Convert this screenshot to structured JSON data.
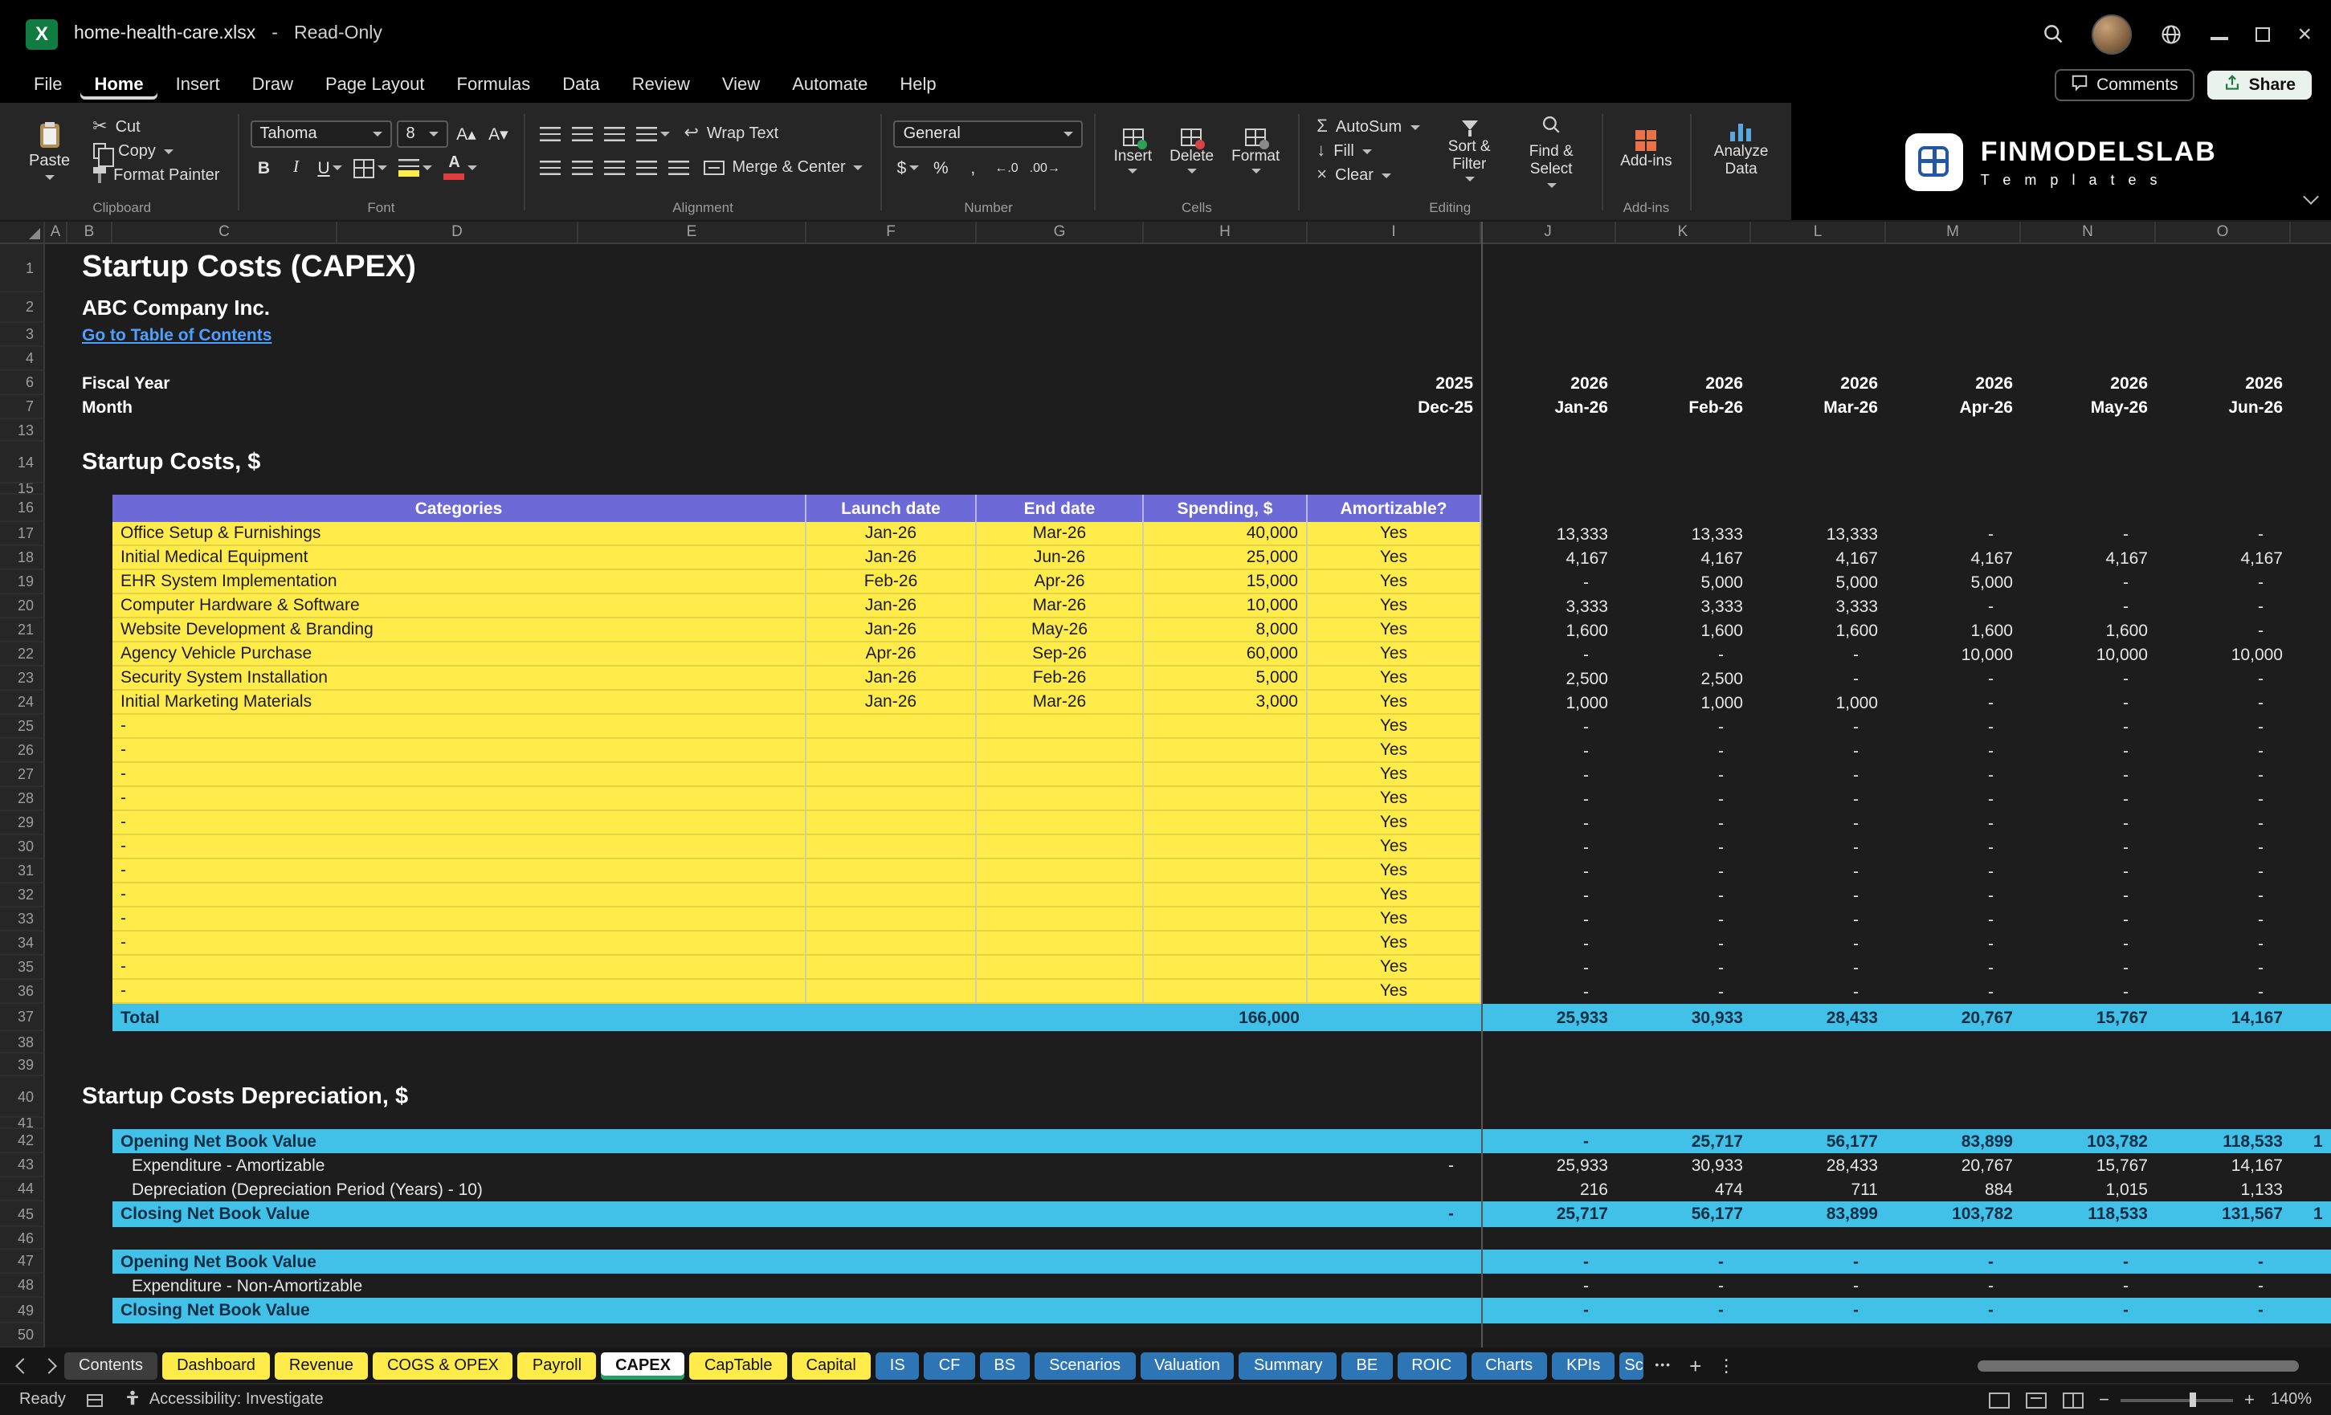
{
  "window": {
    "file_name": "home-health-care.xlsx",
    "separator": "-",
    "mode": "Read-Only"
  },
  "menu": {
    "items": [
      "File",
      "Home",
      "Insert",
      "Draw",
      "Page Layout",
      "Formulas",
      "Data",
      "Review",
      "View",
      "Automate",
      "Help"
    ],
    "active_item": "Home",
    "comments_label": "Comments",
    "share_label": "Share"
  },
  "ribbon": {
    "groups": [
      "Clipboard",
      "Font",
      "Alignment",
      "Number",
      "Cells",
      "Editing",
      "Add-ins"
    ],
    "paste": "Paste",
    "cut": "Cut",
    "copy": "Copy",
    "format_painter": "Format Painter",
    "font_name": "Tahoma",
    "font_size": "8",
    "wrap_text": "Wrap Text",
    "merge_center": "Merge & Center",
    "number_format": "General",
    "insert": "Insert",
    "delete": "Delete",
    "format": "Format",
    "autosum": "AutoSum",
    "fill": "Fill",
    "clear": "Clear",
    "sort_filter": "Sort & Filter",
    "find_select": "Find & Select",
    "addins": "Add-ins",
    "analyze_data": "Analyze Data"
  },
  "logo": {
    "title": "FINMODELSLAB",
    "subtitle": "T e m p l a t e s"
  },
  "grid": {
    "columns": [
      "A",
      "B",
      "C",
      "D",
      "E",
      "F",
      "G",
      "H",
      "I",
      "J",
      "K",
      "L",
      "M",
      "N",
      "O"
    ],
    "rows": [
      {
        "n": "1",
        "h": 30,
        "kind": "title",
        "text": "Startup Costs (CAPEX)"
      },
      {
        "n": "2",
        "h": 19,
        "kind": "subtitle",
        "text": "ABC Company Inc."
      },
      {
        "n": "3",
        "h": 15,
        "kind": "link",
        "text": "Go to Table of Contents"
      },
      {
        "n": "4",
        "h": 15,
        "kind": "blank"
      },
      {
        "n": "6",
        "h": 15,
        "kind": "dates",
        "label": "Fiscal Year",
        "dec": "2025",
        "m": [
          "2026",
          "2026",
          "2026",
          "2026",
          "2026",
          "2026"
        ]
      },
      {
        "n": "7",
        "h": 15,
        "kind": "dates",
        "label": "Month",
        "dec": "Dec-25",
        "m": [
          "Jan-26",
          "Feb-26",
          "Mar-26",
          "Apr-26",
          "May-26",
          "Jun-26"
        ]
      },
      {
        "n": "13",
        "h": 14,
        "kind": "blank"
      },
      {
        "n": "14",
        "h": 26,
        "kind": "section",
        "text": "Startup Costs, $"
      },
      {
        "n": "15",
        "h": 7,
        "kind": "blank"
      },
      {
        "n": "16",
        "h": 17,
        "kind": "thead",
        "c1": "Categories",
        "c2": "Launch date",
        "c3": "End date",
        "c4": "Spending, $",
        "c5": "Amortizable?"
      },
      {
        "n": "17",
        "h": 15,
        "kind": "item",
        "cat": "Office Setup & Furnishings",
        "launch": "Jan-26",
        "end": "Mar-26",
        "spend": "40,000",
        "amort": "Yes",
        "m": [
          "13,333",
          "13,333",
          "13,333",
          "-",
          "-",
          "-"
        ]
      },
      {
        "n": "18",
        "h": 15,
        "kind": "item",
        "cat": "Initial Medical Equipment",
        "launch": "Jan-26",
        "end": "Jun-26",
        "spend": "25,000",
        "amort": "Yes",
        "m": [
          "4,167",
          "4,167",
          "4,167",
          "4,167",
          "4,167",
          "4,167"
        ]
      },
      {
        "n": "19",
        "h": 15,
        "kind": "item",
        "cat": "EHR System Implementation",
        "launch": "Feb-26",
        "end": "Apr-26",
        "spend": "15,000",
        "amort": "Yes",
        "m": [
          "-",
          "5,000",
          "5,000",
          "5,000",
          "-",
          "-"
        ]
      },
      {
        "n": "20",
        "h": 15,
        "kind": "item",
        "cat": "Computer Hardware & Software",
        "launch": "Jan-26",
        "end": "Mar-26",
        "spend": "10,000",
        "amort": "Yes",
        "m": [
          "3,333",
          "3,333",
          "3,333",
          "-",
          "-",
          "-"
        ]
      },
      {
        "n": "21",
        "h": 15,
        "kind": "item",
        "cat": "Website Development & Branding",
        "launch": "Jan-26",
        "end": "May-26",
        "spend": "8,000",
        "amort": "Yes",
        "m": [
          "1,600",
          "1,600",
          "1,600",
          "1,600",
          "1,600",
          "-"
        ]
      },
      {
        "n": "22",
        "h": 15,
        "kind": "item",
        "cat": "Agency Vehicle Purchase",
        "launch": "Apr-26",
        "end": "Sep-26",
        "spend": "60,000",
        "amort": "Yes",
        "m": [
          "-",
          "-",
          "-",
          "10,000",
          "10,000",
          "10,000"
        ]
      },
      {
        "n": "23",
        "h": 15,
        "kind": "item",
        "cat": "Security System Installation",
        "launch": "Jan-26",
        "end": "Feb-26",
        "spend": "5,000",
        "amort": "Yes",
        "m": [
          "2,500",
          "2,500",
          "-",
          "-",
          "-",
          "-"
        ]
      },
      {
        "n": "24",
        "h": 15,
        "kind": "item",
        "cat": "Initial Marketing Materials",
        "launch": "Jan-26",
        "end": "Mar-26",
        "spend": "3,000",
        "amort": "Yes",
        "m": [
          "1,000",
          "1,000",
          "1,000",
          "-",
          "-",
          "-"
        ]
      },
      {
        "n": "25",
        "h": 15,
        "kind": "item",
        "cat": "-",
        "launch": "",
        "end": "",
        "spend": "",
        "amort": "Yes",
        "m": [
          "-",
          "-",
          "-",
          "-",
          "-",
          "-"
        ]
      },
      {
        "n": "26",
        "h": 15,
        "kind": "item",
        "cat": "-",
        "launch": "",
        "end": "",
        "spend": "",
        "amort": "Yes",
        "m": [
          "-",
          "-",
          "-",
          "-",
          "-",
          "-"
        ]
      },
      {
        "n": "27",
        "h": 15,
        "kind": "item",
        "cat": "-",
        "launch": "",
        "end": "",
        "spend": "",
        "amort": "Yes",
        "m": [
          "-",
          "-",
          "-",
          "-",
          "-",
          "-"
        ]
      },
      {
        "n": "28",
        "h": 15,
        "kind": "item",
        "cat": "-",
        "launch": "",
        "end": "",
        "spend": "",
        "amort": "Yes",
        "m": [
          "-",
          "-",
          "-",
          "-",
          "-",
          "-"
        ]
      },
      {
        "n": "29",
        "h": 15,
        "kind": "item",
        "cat": "-",
        "launch": "",
        "end": "",
        "spend": "",
        "amort": "Yes",
        "m": [
          "-",
          "-",
          "-",
          "-",
          "-",
          "-"
        ]
      },
      {
        "n": "30",
        "h": 15,
        "kind": "item",
        "cat": "-",
        "launch": "",
        "end": "",
        "spend": "",
        "amort": "Yes",
        "m": [
          "-",
          "-",
          "-",
          "-",
          "-",
          "-"
        ]
      },
      {
        "n": "31",
        "h": 15,
        "kind": "item",
        "cat": "-",
        "launch": "",
        "end": "",
        "spend": "",
        "amort": "Yes",
        "m": [
          "-",
          "-",
          "-",
          "-",
          "-",
          "-"
        ]
      },
      {
        "n": "32",
        "h": 15,
        "kind": "item",
        "cat": "-",
        "launch": "",
        "end": "",
        "spend": "",
        "amort": "Yes",
        "m": [
          "-",
          "-",
          "-",
          "-",
          "-",
          "-"
        ]
      },
      {
        "n": "33",
        "h": 15,
        "kind": "item",
        "cat": "-",
        "launch": "",
        "end": "",
        "spend": "",
        "amort": "Yes",
        "m": [
          "-",
          "-",
          "-",
          "-",
          "-",
          "-"
        ]
      },
      {
        "n": "34",
        "h": 15,
        "kind": "item",
        "cat": "-",
        "launch": "",
        "end": "",
        "spend": "",
        "amort": "Yes",
        "m": [
          "-",
          "-",
          "-",
          "-",
          "-",
          "-"
        ]
      },
      {
        "n": "35",
        "h": 15,
        "kind": "item",
        "cat": "-",
        "launch": "",
        "end": "",
        "spend": "",
        "amort": "Yes",
        "m": [
          "-",
          "-",
          "-",
          "-",
          "-",
          "-"
        ]
      },
      {
        "n": "36",
        "h": 15,
        "kind": "item",
        "cat": "-",
        "launch": "",
        "end": "",
        "spend": "",
        "amort": "Yes",
        "m": [
          "-",
          "-",
          "-",
          "-",
          "-",
          "-"
        ]
      },
      {
        "n": "37",
        "h": 17,
        "kind": "total",
        "label": "Total",
        "spend": "166,000",
        "m": [
          "25,933",
          "30,933",
          "28,433",
          "20,767",
          "15,767",
          "14,167"
        ]
      },
      {
        "n": "38",
        "h": 14,
        "kind": "blank"
      },
      {
        "n": "39",
        "h": 14,
        "kind": "blank"
      },
      {
        "n": "40",
        "h": 26,
        "kind": "section",
        "text": "Startup Costs Depreciation, $"
      },
      {
        "n": "41",
        "h": 7,
        "kind": "blank"
      },
      {
        "n": "42",
        "h": 15,
        "kind": "band",
        "label": "Opening Net Book Value",
        "dec": "",
        "m": [
          "-",
          "25,717",
          "56,177",
          "83,899",
          "103,782",
          "118,533"
        ],
        "next": "1"
      },
      {
        "n": "43",
        "h": 15,
        "kind": "line",
        "label": "Expenditure - Amortizable",
        "dec": "-",
        "m": [
          "25,933",
          "30,933",
          "28,433",
          "20,767",
          "15,767",
          "14,167"
        ]
      },
      {
        "n": "44",
        "h": 15,
        "kind": "line",
        "label": "Depreciation (Depreciation Period (Years) - 10)",
        "dec": "",
        "m": [
          "216",
          "474",
          "711",
          "884",
          "1,015",
          "1,133"
        ]
      },
      {
        "n": "45",
        "h": 16,
        "kind": "band",
        "label": "Closing Net Book Value",
        "dec": "-",
        "m": [
          "25,717",
          "56,177",
          "83,899",
          "103,782",
          "118,533",
          "131,567"
        ],
        "next": "1"
      },
      {
        "n": "46",
        "h": 14,
        "kind": "blank"
      },
      {
        "n": "47",
        "h": 15,
        "kind": "band",
        "label": "Opening Net Book Value",
        "dec": "",
        "m": [
          "-",
          "-",
          "-",
          "-",
          "-",
          "-"
        ],
        "next": ""
      },
      {
        "n": "48",
        "h": 15,
        "kind": "line",
        "label": "Expenditure - Non-Amortizable",
        "dec": "",
        "m": [
          "-",
          "-",
          "-",
          "-",
          "-",
          "-"
        ]
      },
      {
        "n": "49",
        "h": 16,
        "kind": "band",
        "label": "Closing Net Book Value",
        "dec": "",
        "m": [
          "-",
          "-",
          "-",
          "-",
          "-",
          "-"
        ],
        "next": ""
      },
      {
        "n": "50",
        "h": 15,
        "kind": "blank"
      }
    ]
  },
  "tabs": {
    "items": [
      {
        "label": "Contents",
        "style": "plain"
      },
      {
        "label": "Dashboard",
        "style": "yellow"
      },
      {
        "label": "Revenue",
        "style": "yellow"
      },
      {
        "label": "COGS & OPEX",
        "style": "yellow"
      },
      {
        "label": "Payroll",
        "style": "yellow"
      },
      {
        "label": "CAPEX",
        "style": "active"
      },
      {
        "label": "CapTable",
        "style": "yellow"
      },
      {
        "label": "Capital",
        "style": "yellow"
      },
      {
        "label": "IS",
        "style": "blue"
      },
      {
        "label": "CF",
        "style": "blue"
      },
      {
        "label": "BS",
        "style": "blue"
      },
      {
        "label": "Scenarios",
        "style": "blue"
      },
      {
        "label": "Valuation",
        "style": "blue"
      },
      {
        "label": "Summary",
        "style": "blue"
      },
      {
        "label": "BE",
        "style": "blue"
      },
      {
        "label": "ROIC",
        "style": "blue"
      },
      {
        "label": "Charts",
        "style": "blue"
      },
      {
        "label": "KPIs",
        "style": "blue"
      },
      {
        "label": "Sc",
        "style": "blue-clipped"
      }
    ]
  },
  "status": {
    "ready": "Ready",
    "accessibility": "Accessibility: Investigate",
    "zoom_level": "140%"
  },
  "icons": {
    "excel_x": "X",
    "scissors": "✂",
    "sigma": "Σ",
    "fill_arrow": "↓",
    "clear_x": "×",
    "font_up": "A▴",
    "font_down": "A▾",
    "bold": "B",
    "italic": "I",
    "underline": "U",
    "accounting": "$",
    "percent": "%",
    "comma": ",",
    "dec_inc": "←.0",
    "dec_dec": ".00→",
    "wrap": "↩",
    "more": "•••",
    "plus": "+",
    "kebab": "⋮",
    "minus": "−",
    "close": "×"
  },
  "colors": {
    "accent-green": "#107c41",
    "input-yellow": "#ffec4a",
    "header-purple": "#6d6ad8",
    "band-cyan": "#41c0e8",
    "band-text": "#0b2e44",
    "link-blue": "#4da0ff",
    "tab-blue": "#2e75b6",
    "active-green": "#21a366"
  }
}
